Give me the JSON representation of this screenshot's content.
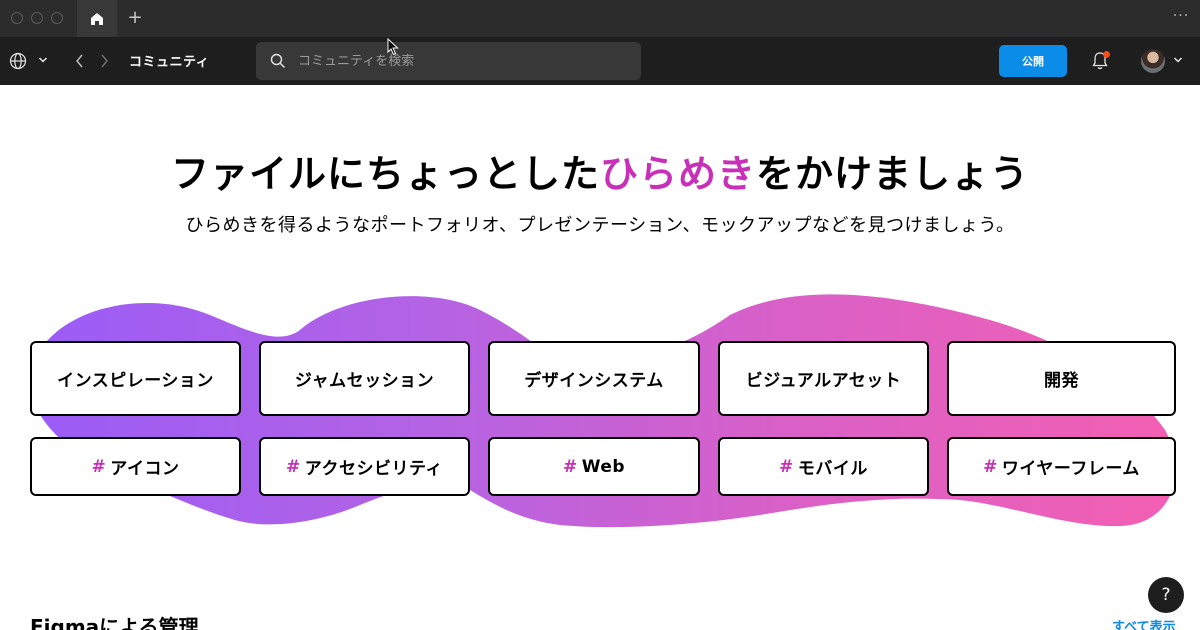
{
  "tabs": {
    "add_label": "+",
    "more_label": "···"
  },
  "nav": {
    "title": "コミュニティ",
    "search_placeholder": "コミュニティを検索",
    "publish_label": "公開"
  },
  "hero": {
    "title_before": "ファイルにちょっとした",
    "title_accent": "ひらめき",
    "title_after": "をかけましょう",
    "subtitle": "ひらめきを得るようなポートフォリオ、プレゼンテーション、モックアップなどを見つけましょう。"
  },
  "categories": [
    {
      "label": "インスピレーション"
    },
    {
      "label": "ジャムセッション"
    },
    {
      "label": "デザインシステム"
    },
    {
      "label": "ビジュアルアセット"
    },
    {
      "label": "開発"
    }
  ],
  "tags": [
    {
      "hash": "#",
      "label": "アイコン"
    },
    {
      "hash": "#",
      "label": "アクセシビリティ"
    },
    {
      "hash": "#",
      "label": "Web"
    },
    {
      "hash": "#",
      "label": "モバイル"
    },
    {
      "hash": "#",
      "label": "ワイヤーフレーム"
    }
  ],
  "section": {
    "title": "Figmaによる管理",
    "see_all": "すべて表示"
  },
  "help_label": "?",
  "colors": {
    "accent": "#c930b8",
    "primary_button": "#0c8ce9",
    "blob_start": "#9b5cf6",
    "blob_end": "#f05fb0",
    "notification_dot": "#f24e1e"
  },
  "icons": [
    "home-icon",
    "globe-icon",
    "chevron-down-icon",
    "back-arrow-icon",
    "forward-arrow-icon",
    "search-icon",
    "bell-icon",
    "help-icon"
  ]
}
